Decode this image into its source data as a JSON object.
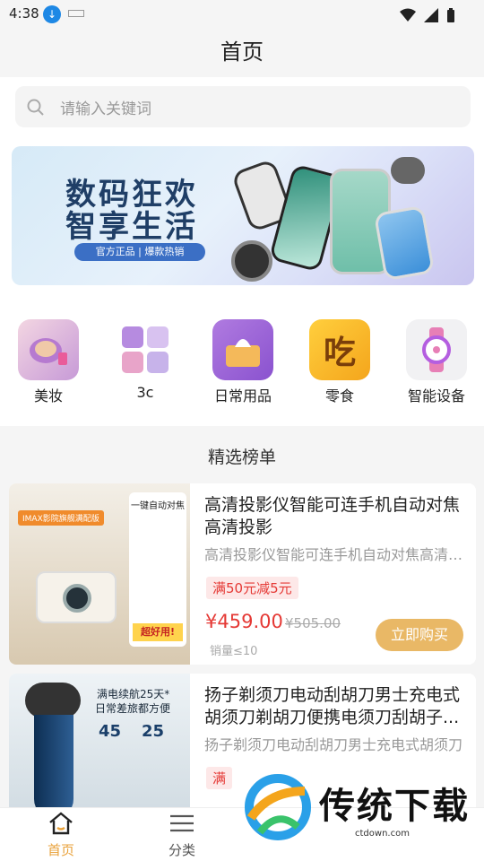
{
  "status": {
    "time": "4:38"
  },
  "header": {
    "title": "首页"
  },
  "search": {
    "placeholder": "请输入关键词"
  },
  "banner": {
    "line1": "数码狂欢",
    "line2": "智享生活",
    "tag": "官方正品 | 爆款热销"
  },
  "categories": [
    {
      "label": "美妆",
      "icon": "makeup-icon"
    },
    {
      "label": "3c",
      "icon": "appliances-icon"
    },
    {
      "label": "日常用品",
      "icon": "tissue-box-icon"
    },
    {
      "label": "零食",
      "icon": "snack-icon"
    },
    {
      "label": "智能设备",
      "icon": "smartwatch-icon"
    }
  ],
  "section": {
    "title": "精选榜单"
  },
  "products": [
    {
      "title": "高清投影仪智能可连手机自动对焦高清投影",
      "subtitle": "高清投影仪智能可连手机自动对焦高清投影",
      "coupon": "满50元减5元",
      "price": "¥459.00",
      "old_price": "¥505.00",
      "sales": "销量≤10",
      "buy_label": "立即购买",
      "img_badge": "IMAX影院旗舰满配版",
      "img_side_title": "一键自动对焦",
      "img_side_bottom": "超好用!"
    },
    {
      "title": "扬子剃须刀电动刮胡刀男士充电式胡须刀剃胡刀便携电须刀刮胡子...",
      "subtitle": "扬子剃须刀电动刮胡刀男士充电式胡须刀",
      "coupon": "满",
      "img_line1": "满电续航25天*",
      "img_line2": "日常差旅都方便",
      "img_stat1": "45",
      "img_stat2": "25"
    }
  ],
  "tabbar": {
    "home": "首页",
    "category": "分类"
  },
  "watermark": {
    "text": "传统下载",
    "sub": "ctdown.com"
  },
  "colors": {
    "accent": "#e9b866",
    "price": "#e53935",
    "tab_active": "#e9a23b"
  }
}
